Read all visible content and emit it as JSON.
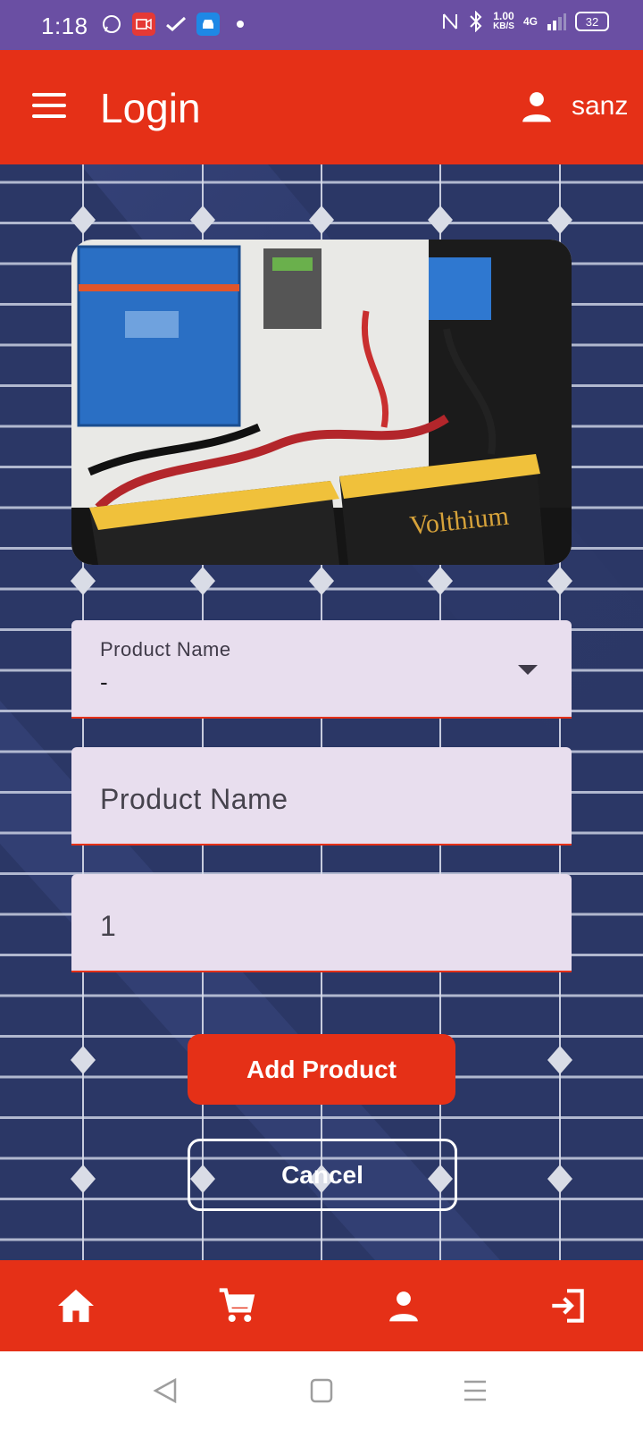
{
  "status_bar": {
    "time": "1:18",
    "speed_value": "1.00",
    "speed_unit": "KB/S",
    "network": "4G",
    "battery": "32",
    "icons": [
      "whatsapp-icon",
      "video-record-icon",
      "checkmark-app-icon",
      "car-app-icon",
      "dot-icon",
      "nfc-icon",
      "bluetooth-icon",
      "signal-icon"
    ]
  },
  "app_bar": {
    "title": "Login",
    "user_name": "sanz"
  },
  "form": {
    "dropdown_label": "Product Name",
    "dropdown_value": "-",
    "name_placeholder": "Product Name",
    "quantity_value": "1"
  },
  "buttons": {
    "add_label": "Add Product",
    "cancel_label": "Cancel"
  },
  "bottom_nav": {
    "items": [
      "home-icon",
      "cart-icon",
      "person-icon",
      "logout-icon"
    ]
  },
  "colors": {
    "status_bar": "#6a4fa3",
    "accent": "#e53017",
    "panel_bg": "#2b3766",
    "field_bg": "#e8deee"
  }
}
